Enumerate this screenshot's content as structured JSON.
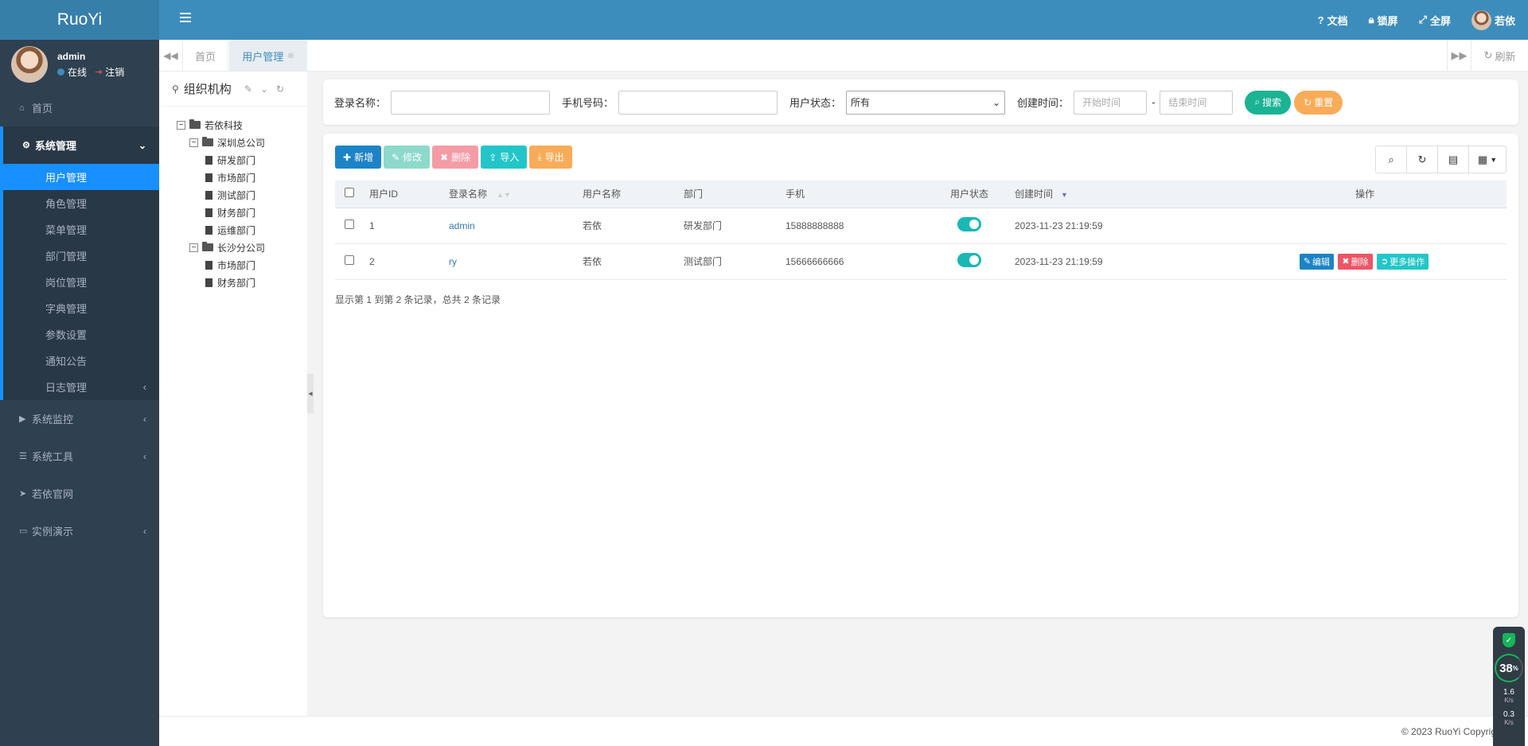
{
  "app": {
    "logo": "RuoYi"
  },
  "user": {
    "name": "admin",
    "status": "在线",
    "logout": "注销"
  },
  "sidebar": {
    "home": "首页",
    "system": "系统管理",
    "system_items": [
      "用户管理",
      "角色管理",
      "菜单管理",
      "部门管理",
      "岗位管理",
      "字典管理",
      "参数设置",
      "通知公告",
      "日志管理"
    ],
    "monitor": "系统监控",
    "tools": "系统工具",
    "website": "若依官网",
    "demo": "实例演示"
  },
  "topbar": {
    "docs": "文档",
    "lock": "锁屏",
    "fullscreen": "全屏",
    "username": "若依"
  },
  "tabs": {
    "home": "首页",
    "active": "用户管理",
    "refresh": "刷新"
  },
  "tree": {
    "title": "组织机构",
    "root": "若依科技",
    "branch1": "深圳总公司",
    "branch1_children": [
      "研发部门",
      "市场部门",
      "测试部门",
      "财务部门",
      "运维部门"
    ],
    "branch2": "长沙分公司",
    "branch2_children": [
      "市场部门",
      "财务部门"
    ]
  },
  "search": {
    "login_name_label": "登录名称：",
    "phone_label": "手机号码：",
    "status_label": "用户状态：",
    "status_value": "所有",
    "created_label": "创建时间：",
    "start_placeholder": "开始时间",
    "separator": "-",
    "end_placeholder": "结束时间",
    "search_btn": "搜索",
    "reset_btn": "重置"
  },
  "toolbar": {
    "add": "新增",
    "edit": "修改",
    "delete": "删除",
    "import": "导入",
    "export": "导出"
  },
  "table": {
    "headers": {
      "id": "用户ID",
      "login": "登录名称",
      "name": "用户名称",
      "dept": "部门",
      "phone": "手机",
      "status": "用户状态",
      "created": "创建时间",
      "ops": "操作"
    },
    "rows": [
      {
        "id": "1",
        "login": "admin",
        "name": "若依",
        "dept": "研发部门",
        "phone": "15888888888",
        "status": true,
        "created": "2023-11-23 21:19:59"
      },
      {
        "id": "2",
        "login": "ry",
        "name": "若依",
        "dept": "测试部门",
        "phone": "15666666666",
        "status": true,
        "created": "2023-11-23 21:19:59"
      }
    ],
    "ops": {
      "edit": "编辑",
      "delete": "删除",
      "more": "更多操作"
    },
    "pager_info": "显示第 1 到第 2 条记录，总共 2 条记录"
  },
  "footer": "© 2023 RuoYi Copyright",
  "widget": {
    "cpu": "38",
    "cpu_unit": "%",
    "up": "1.6",
    "up_unit": "K/s",
    "down": "0.3",
    "down_unit": "K/s"
  },
  "colors": {
    "sidebar": "#2f4050",
    "topbar": "#3c8dbc",
    "accent": "#1890ff"
  }
}
